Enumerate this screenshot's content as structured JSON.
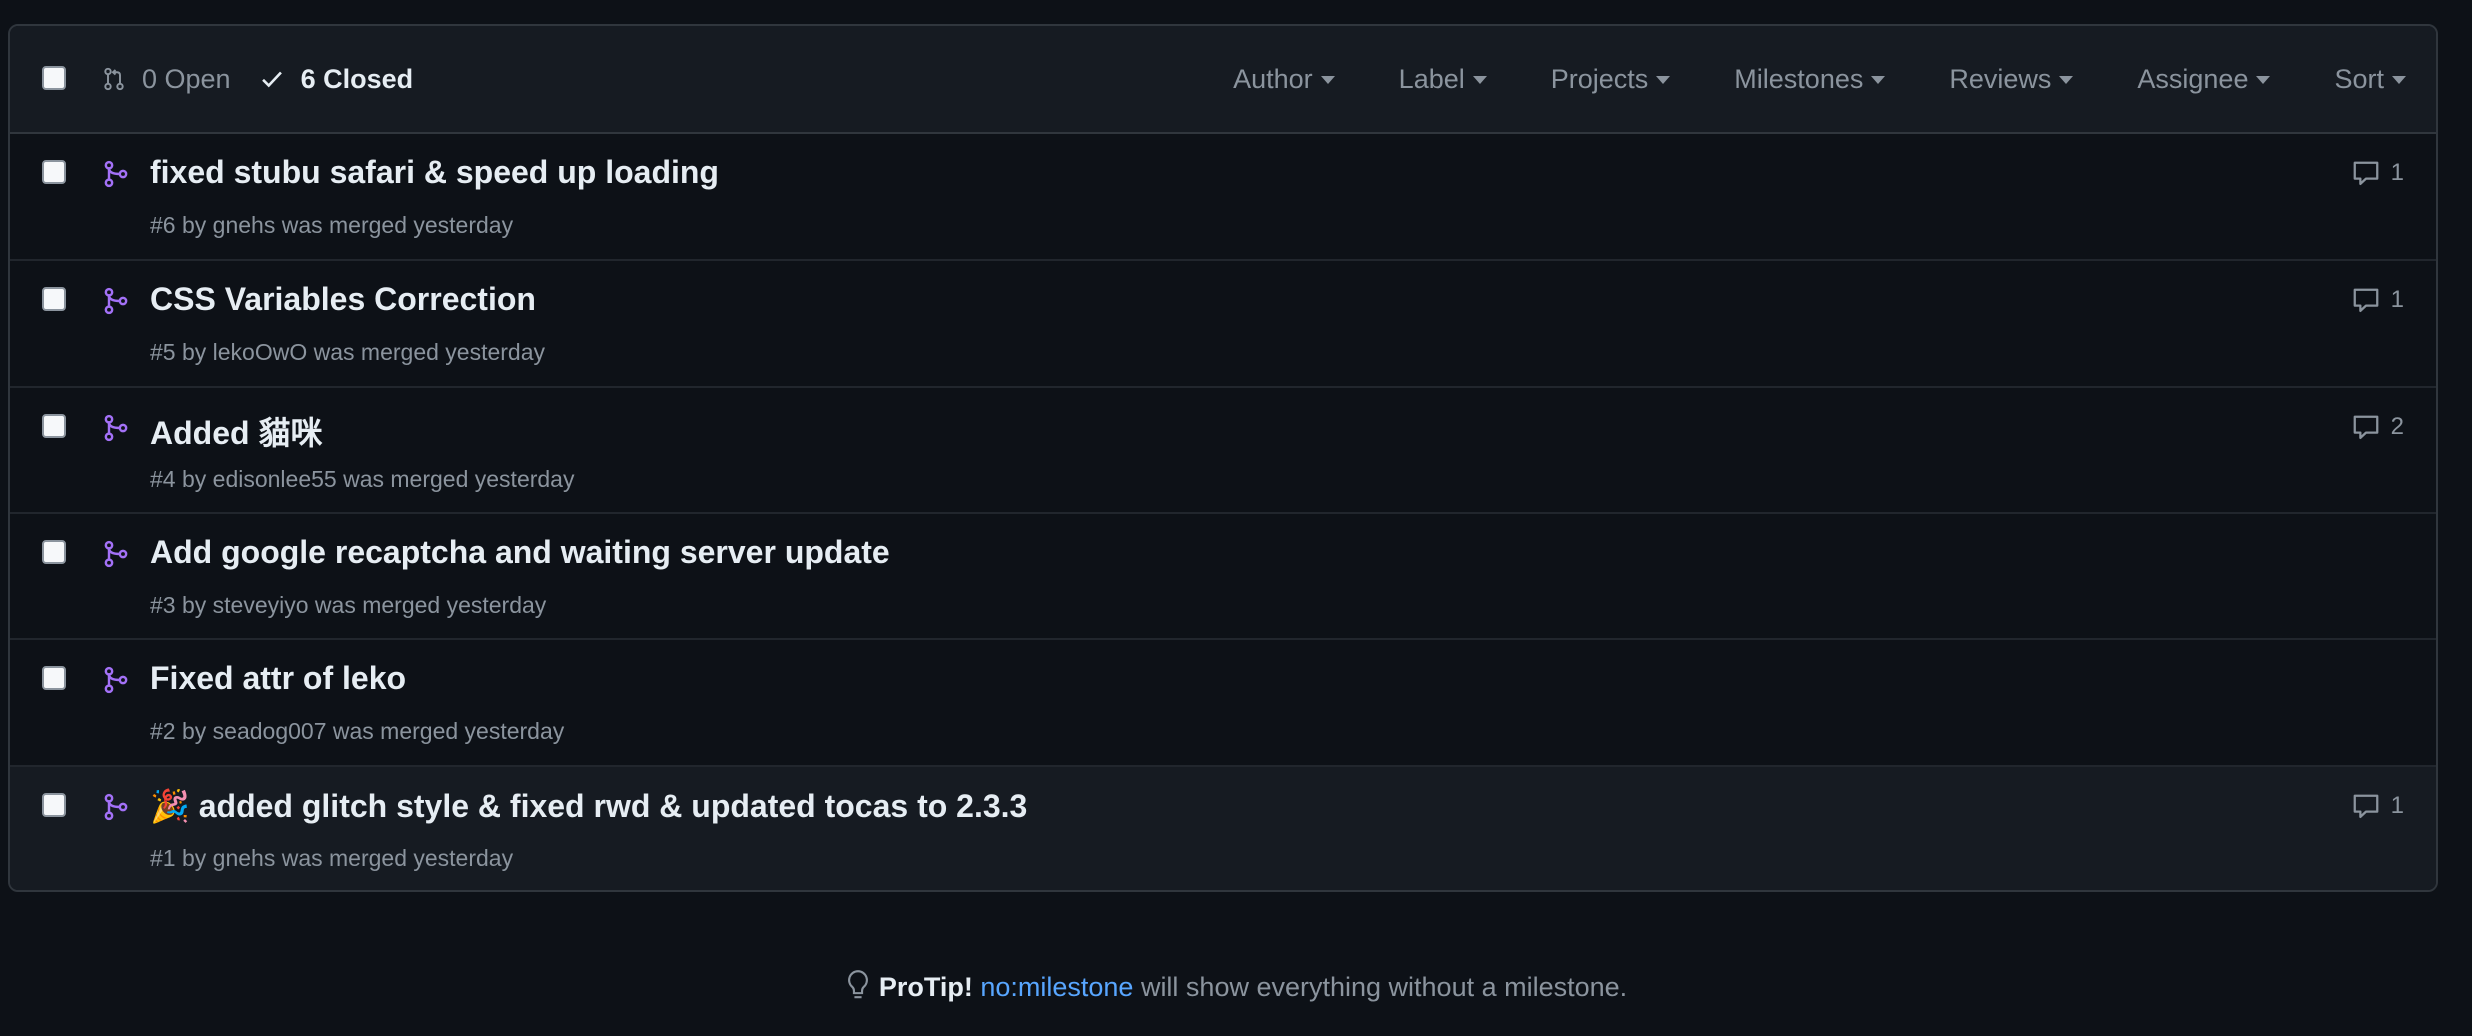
{
  "header": {
    "open_label": "0 Open",
    "closed_label": "6 Closed",
    "filters": [
      "Author",
      "Label",
      "Projects",
      "Milestones",
      "Reviews",
      "Assignee",
      "Sort"
    ]
  },
  "pull_requests": [
    {
      "title": "fixed stubu safari & speed up loading",
      "meta": "#6 by gnehs was merged yesterday",
      "comments": "1"
    },
    {
      "title": "CSS Variables Correction",
      "meta": "#5 by lekoOwO was merged yesterday",
      "comments": "1"
    },
    {
      "title": "Added 貓咪",
      "meta": "#4 by edisonlee55 was merged yesterday",
      "comments": "2"
    },
    {
      "title": "Add google recaptcha and waiting server update",
      "meta": "#3 by steveyiyo was merged yesterday",
      "comments": ""
    },
    {
      "title": "Fixed attr of leko",
      "meta": "#2 by seadog007 was merged yesterday",
      "comments": ""
    },
    {
      "title": "🎉 added glitch style & fixed rwd & updated tocas to 2.3.3",
      "meta": "#1 by gnehs was merged yesterday",
      "comments": "1"
    }
  ],
  "protip": {
    "lead": "ProTip!",
    "link": "no:milestone",
    "rest": " will show everything without a milestone."
  },
  "colors": {
    "background": "#0d1117",
    "header_bg": "#161b22",
    "merged_purple": "#a371f7",
    "link_blue": "#58a6ff",
    "muted": "#8b949e"
  },
  "icons": {
    "open": "git-pull-request-icon",
    "closed": "check-icon",
    "row": "git-merge-icon",
    "comments": "comment-icon",
    "protip": "light-bulb-icon"
  }
}
